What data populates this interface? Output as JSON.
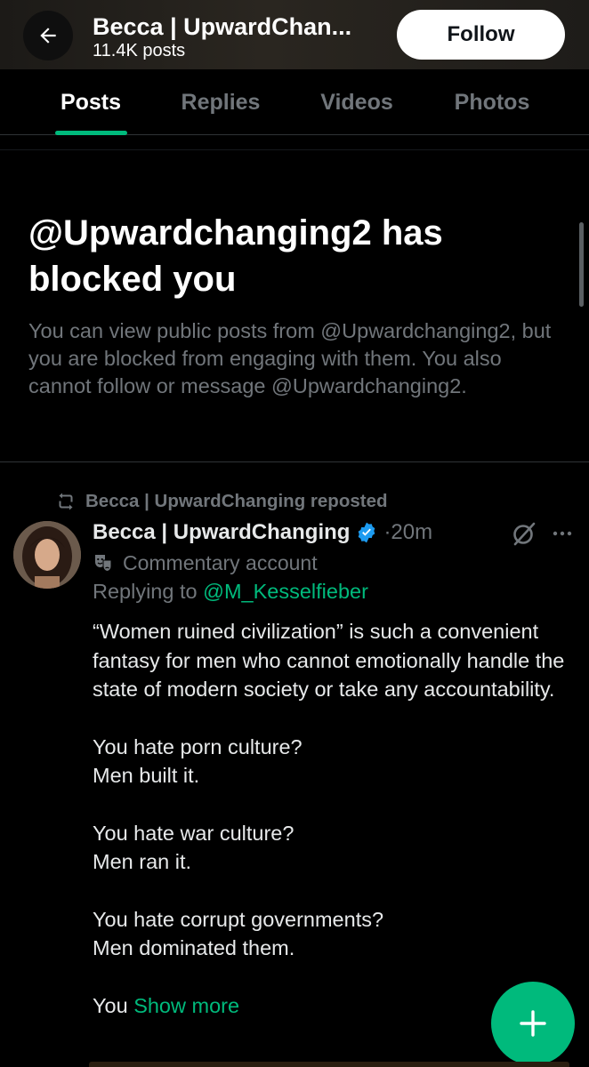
{
  "header": {
    "title": "Becca | UpwardChan...",
    "subtitle": "11.4K posts",
    "follow_label": "Follow",
    "back_icon": "arrow-left-icon"
  },
  "tabs": [
    {
      "label": "Posts",
      "active": true
    },
    {
      "label": "Replies",
      "active": false
    },
    {
      "label": "Videos",
      "active": false
    },
    {
      "label": "Photos",
      "active": false
    }
  ],
  "blocked": {
    "heading": "@Upwardchanging2 has blocked you",
    "text": "You can view public posts from @Upwardchanging2, but you are blocked from engaging with them. You also cannot follow or message @Upwardchanging2."
  },
  "post": {
    "repost_label": "Becca | UpwardChanging reposted",
    "author_name": "Becca | UpwardChanging",
    "verified": true,
    "time": "·20m",
    "account_label": "Commentary account",
    "replying_prefix": "Replying to ",
    "replying_to": "@M_Kesselfieber",
    "body": [
      "“Women ruined civilization” is such a convenient fantasy for men who cannot emotionally handle the state of modern society or take any accountability.",
      "You hate porn culture?\nMen built it.",
      "You hate war culture?\nMen ran it.",
      "You hate corrupt governments?\nMen dominated them."
    ],
    "truncated_start": "You ",
    "show_more": "Show more"
  },
  "colors": {
    "accent": "#00ba7c",
    "verified": "#1d9bf0",
    "muted_text": "#71767b",
    "background": "#000000"
  },
  "fab": {
    "icon": "plus-icon"
  }
}
